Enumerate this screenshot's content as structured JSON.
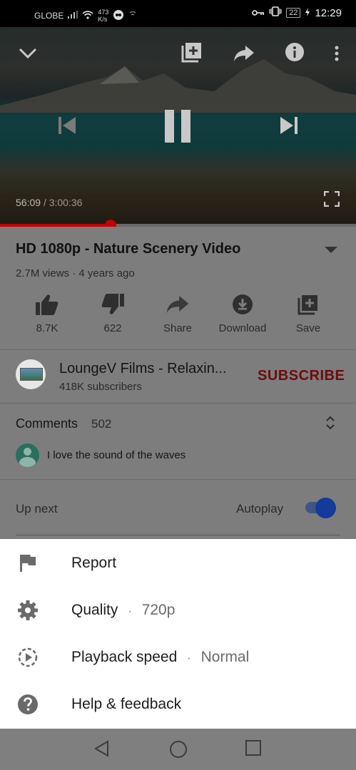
{
  "status_bar": {
    "carrier": "GLOBE",
    "net_speed_value": "473",
    "net_speed_unit": "K/s",
    "battery": "22",
    "time": "12:29"
  },
  "player": {
    "current_time": "56:09",
    "duration": "3:00:36",
    "progress_fraction": 0.31
  },
  "video": {
    "title": "HD 1080p - Nature Scenery Video",
    "meta": "2.7M views · 4 years ago"
  },
  "actions": [
    {
      "label": "8.7K",
      "icon": "thumb-up-icon"
    },
    {
      "label": "622",
      "icon": "thumb-down-icon"
    },
    {
      "label": "Share",
      "icon": "share-icon"
    },
    {
      "label": "Download",
      "icon": "download-icon"
    },
    {
      "label": "Save",
      "icon": "playlist-add-icon"
    }
  ],
  "channel": {
    "name": "LoungeV Films - Relaxin...",
    "subscribers": "418K subscribers",
    "subscribe_label": "SUBSCRIBE"
  },
  "comments": {
    "label": "Comments",
    "count": "502",
    "top_comment": "I love the sound of the waves"
  },
  "up_next": {
    "label": "Up next",
    "autoplay_label": "Autoplay",
    "autoplay_on": true
  },
  "menu": {
    "items": [
      {
        "label": "Report",
        "value": "",
        "icon": "flag-icon"
      },
      {
        "label": "Quality",
        "value": "720p",
        "icon": "gear-icon"
      },
      {
        "label": "Playback speed",
        "value": "Normal",
        "icon": "playback-speed-icon"
      },
      {
        "label": "Help & feedback",
        "value": "",
        "icon": "help-icon"
      }
    ],
    "separator": "·"
  },
  "colors": {
    "progress": "#c40000",
    "subscribe": "#6b0c0c",
    "toggle": "#143a9a"
  }
}
